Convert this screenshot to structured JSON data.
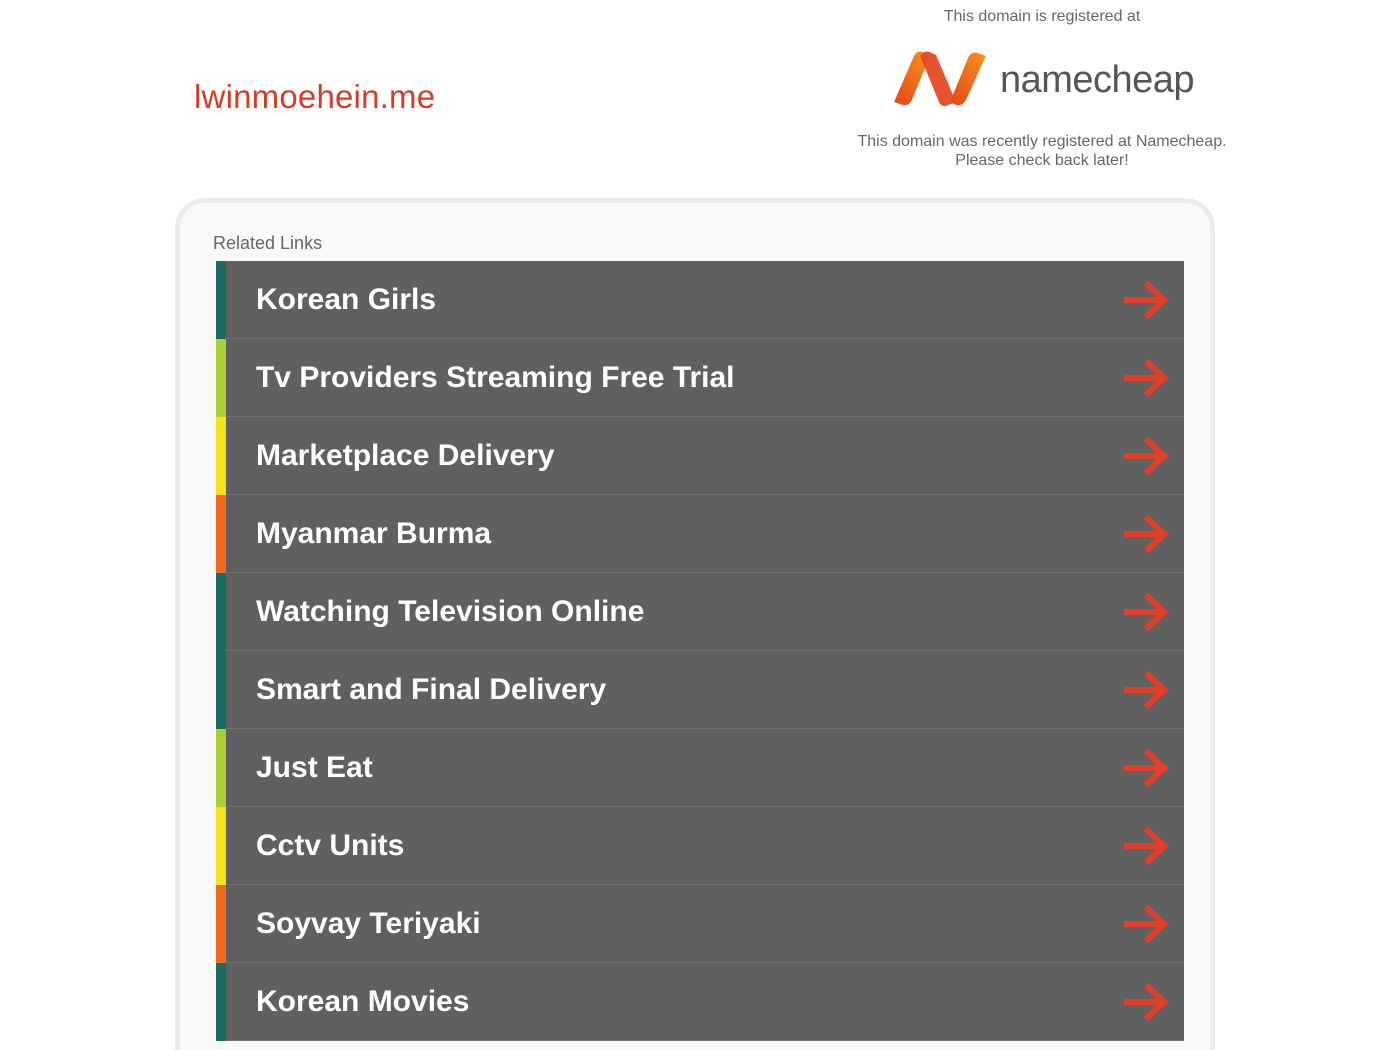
{
  "header": {
    "domain": "lwinmoehein.me"
  },
  "registrar": {
    "registered_at_text": "This domain is registered at",
    "logo_wordmark": "namecheap",
    "notice_line1": "This domain was recently registered at Namecheap.",
    "notice_line2": "Please check back later!"
  },
  "related": {
    "title": "Related Links",
    "items": [
      {
        "label": "Korean Girls",
        "stripe_color": "#1d6b63"
      },
      {
        "label": "Tv Providers Streaming Free Trial",
        "stripe_color": "#a9cf38"
      },
      {
        "label": "Marketplace Delivery",
        "stripe_color": "#f4e21c"
      },
      {
        "label": "Myanmar Burma",
        "stripe_color": "#ef6a1f"
      },
      {
        "label": "Watching Television Online",
        "stripe_color": "#1d6b63"
      },
      {
        "label": "Smart and Final Delivery",
        "stripe_color": "#1d6b63"
      },
      {
        "label": "Just Eat",
        "stripe_color": "#a9cf38"
      },
      {
        "label": "Cctv Units",
        "stripe_color": "#f4e21c"
      },
      {
        "label": "Soyvay Teriyaki",
        "stripe_color": "#ef6a1f"
      },
      {
        "label": "Korean Movies",
        "stripe_color": "#1d6b63"
      }
    ]
  },
  "colors": {
    "accent": "#d13d26",
    "arrow": "#e2402b",
    "row_background": "#606060",
    "logo_orange_start": "#f26a21",
    "logo_orange_end": "#e3451d"
  },
  "icons": {
    "row_arrow": "right-arrow-icon",
    "logo": "namecheap-n-icon"
  }
}
